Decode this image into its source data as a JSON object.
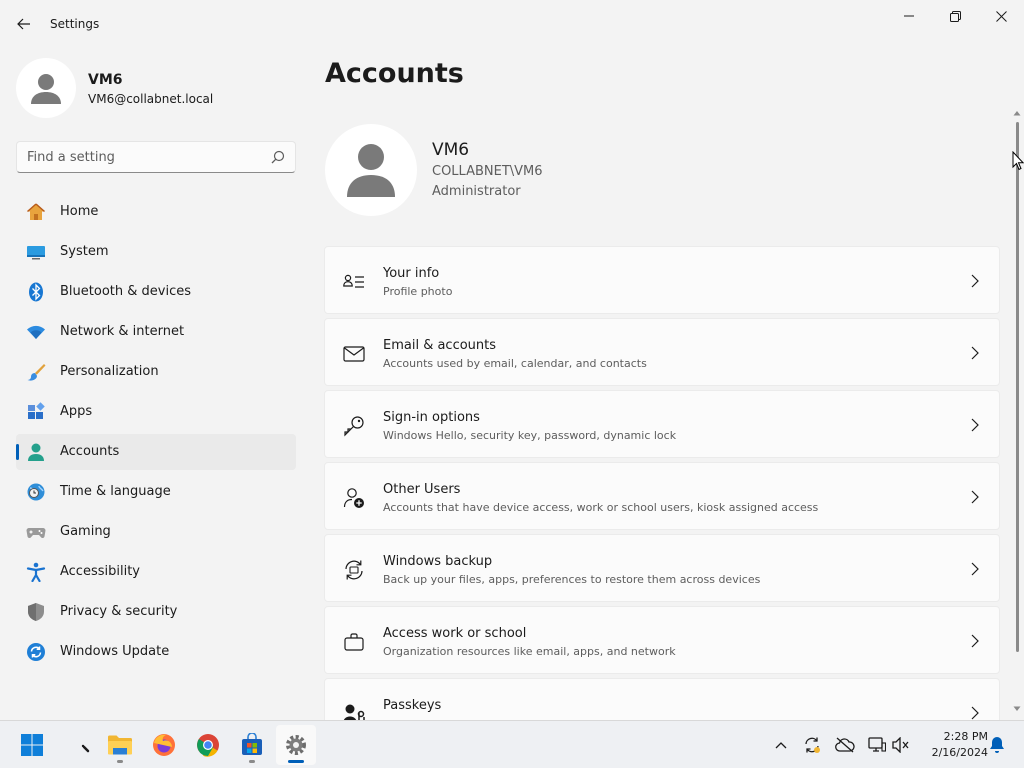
{
  "window": {
    "title": "Settings"
  },
  "profile": {
    "name": "VM6",
    "email": "VM6@collabnet.local"
  },
  "search": {
    "placeholder": "Find a setting"
  },
  "nav": [
    {
      "label": "Home",
      "icon": "home-icon"
    },
    {
      "label": "System",
      "icon": "system-icon"
    },
    {
      "label": "Bluetooth & devices",
      "icon": "bluetooth-icon"
    },
    {
      "label": "Network & internet",
      "icon": "wifi-icon"
    },
    {
      "label": "Personalization",
      "icon": "brush-icon"
    },
    {
      "label": "Apps",
      "icon": "apps-icon"
    },
    {
      "label": "Accounts",
      "icon": "person-icon",
      "active": true
    },
    {
      "label": "Time & language",
      "icon": "globe-clock-icon"
    },
    {
      "label": "Gaming",
      "icon": "gamepad-icon"
    },
    {
      "label": "Accessibility",
      "icon": "accessibility-icon"
    },
    {
      "label": "Privacy & security",
      "icon": "shield-icon"
    },
    {
      "label": "Windows Update",
      "icon": "update-icon"
    }
  ],
  "page": {
    "title": "Accounts"
  },
  "account": {
    "name": "VM6",
    "domain": "COLLABNET\\VM6",
    "role": "Administrator"
  },
  "cards": [
    {
      "title": "Your info",
      "subtitle": "Profile photo",
      "icon": "contact-card-icon"
    },
    {
      "title": "Email & accounts",
      "subtitle": "Accounts used by email, calendar, and contacts",
      "icon": "mail-icon"
    },
    {
      "title": "Sign-in options",
      "subtitle": "Windows Hello, security key, password, dynamic lock",
      "icon": "key-icon"
    },
    {
      "title": "Other Users",
      "subtitle": "Accounts that have device access, work or school users, kiosk assigned access",
      "icon": "person-add-icon"
    },
    {
      "title": "Windows backup",
      "subtitle": "Back up your files, apps, preferences to restore them across devices",
      "icon": "backup-icon"
    },
    {
      "title": "Access work or school",
      "subtitle": "Organization resources like email, apps, and network",
      "icon": "briefcase-icon"
    },
    {
      "title": "Passkeys",
      "subtitle": "",
      "icon": "passkey-icon"
    }
  ],
  "taskbar": {
    "apps": [
      "start-icon",
      "widget-icon",
      "file-explorer-icon",
      "firefox-icon",
      "chrome-icon",
      "store-icon",
      "settings-icon"
    ],
    "tray": [
      "chevron-up-icon",
      "sync-icon",
      "cloud-off-icon",
      "network-icon",
      "volume-mute-icon"
    ],
    "time": "2:28 PM",
    "date": "2/16/2024"
  },
  "colors": {
    "accent": "#005fb8",
    "background": "#f3f3f3",
    "card": "#fbfbfb"
  }
}
